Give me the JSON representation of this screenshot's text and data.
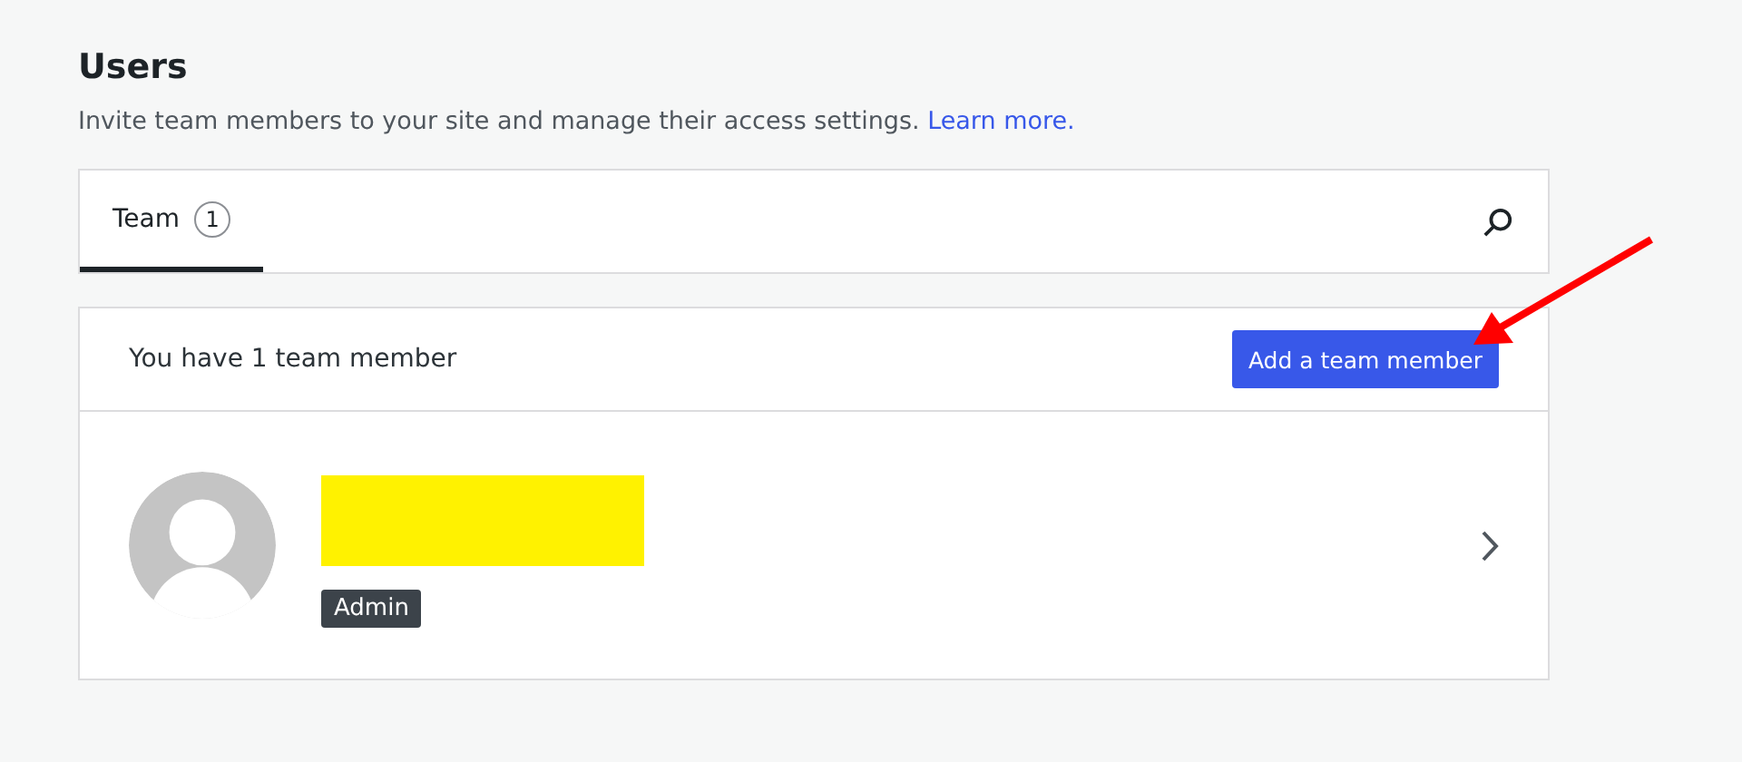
{
  "page": {
    "title": "Users",
    "description": "Invite team members to your site and manage their access settings.",
    "link": "Learn more."
  },
  "tabs": [
    {
      "label": "Team",
      "count": "1",
      "selected": true
    }
  ],
  "team": {
    "summary": "You have 1 team member",
    "add_button": "Add a team member",
    "members": [
      {
        "name_redacted": true,
        "role": "Admin"
      }
    ]
  },
  "annotations": [
    {
      "kind": "arrow",
      "color": "#ff0000"
    }
  ]
}
